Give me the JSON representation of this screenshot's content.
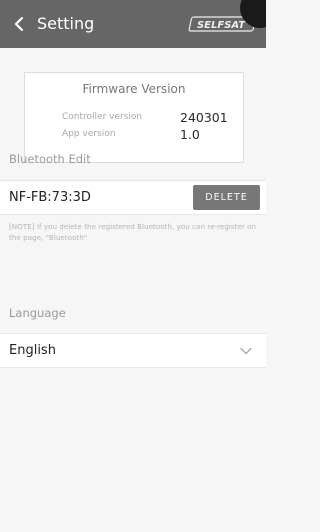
{
  "header": {
    "back_icon": "chevron-left-icon",
    "title": "Setting",
    "brand": "SELFSAT"
  },
  "firmware": {
    "title": "Firmware Version",
    "rows": [
      {
        "label": "Controller version",
        "value": "240301"
      },
      {
        "label": "App version",
        "value": "1.0"
      }
    ]
  },
  "bluetooth": {
    "section_label": "Bluetooth Edit",
    "device_name": "NF-FB:73:3D",
    "delete_label": "DELETE",
    "note": "[NOTE] If you delete the registered Bluetooth, you can re-register on the page, \"Bluetooth\""
  },
  "language": {
    "section_label": "Language",
    "selected": "English",
    "dropdown_icon": "chevron-down-icon"
  },
  "colors": {
    "header_bg": "#666666",
    "page_bg": "#f6f6f6",
    "button_bg": "#777777"
  }
}
